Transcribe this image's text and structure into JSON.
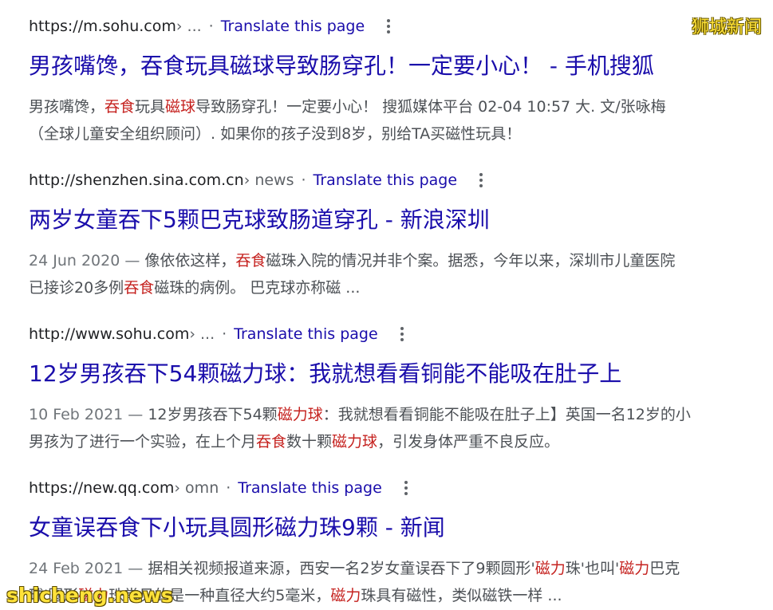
{
  "watermarks": {
    "top_right": "狮城新闻",
    "bottom_left": "shicheng.news"
  },
  "results": [
    {
      "url_domain": "https://m.sohu.com",
      "url_path": " › ...",
      "separator": "·",
      "translate": "Translate this page",
      "title": "男孩嘴馋，吞食玩具磁球导致肠穿孔！一定要小心！ - 手机搜狐",
      "snippet_line1": [
        {
          "text": "男孩嘴馋，",
          "hl": false
        },
        {
          "text": "吞食",
          "hl": true
        },
        {
          "text": "玩具",
          "hl": false
        },
        {
          "text": "磁球",
          "hl": true
        },
        {
          "text": "导致肠穿孔！一定要小心！ 搜狐媒体平台 02-04 10:57 大. 文/张咏梅",
          "hl": false
        }
      ],
      "snippet_line2": [
        {
          "text": "（全球儿童安全组织顾问）. 如果你的孩子没到8岁，别给TA买磁性玩具！",
          "hl": false
        }
      ]
    },
    {
      "url_domain": "http://shenzhen.sina.com.cn",
      "url_path": " › news",
      "separator": "·",
      "translate": "Translate this page",
      "title": "两岁女童吞下5颗巴克球致肠道穿孔 - 新浪深圳",
      "date": "24 Jun 2020 — ",
      "snippet_line1": [
        {
          "text": "像依依这样，",
          "hl": false
        },
        {
          "text": "吞食",
          "hl": true
        },
        {
          "text": "磁珠入院的情况并非个案。据悉，今年以来，深圳市儿童医院",
          "hl": false
        }
      ],
      "snippet_line2": [
        {
          "text": "已接诊20多例",
          "hl": false
        },
        {
          "text": "吞食",
          "hl": true
        },
        {
          "text": "磁珠的病例。 巴克球亦称磁 ...",
          "hl": false
        }
      ]
    },
    {
      "url_domain": "http://www.sohu.com",
      "url_path": " › ...",
      "separator": "·",
      "translate": "Translate this page",
      "title": "12岁男孩吞下54颗磁力球：我就想看看铜能不能吸在肚子上",
      "date": "10 Feb 2021 — ",
      "snippet_line1": [
        {
          "text": "12岁男孩吞下54颗",
          "hl": false
        },
        {
          "text": "磁力球",
          "hl": true
        },
        {
          "text": "：我就想看看铜能不能吸在肚子上】英国一名12岁的小",
          "hl": false
        }
      ],
      "snippet_line2": [
        {
          "text": "男孩为了进行一个实验，在上个月",
          "hl": false
        },
        {
          "text": "吞食",
          "hl": true
        },
        {
          "text": "数十颗",
          "hl": false
        },
        {
          "text": "磁力球",
          "hl": true
        },
        {
          "text": "，引发身体严重不良反应。",
          "hl": false
        }
      ]
    },
    {
      "url_domain": "https://new.qq.com",
      "url_path": " › omn",
      "separator": "·",
      "translate": "Translate this page",
      "title": "女童误吞食下小玩具圆形磁力珠9颗 - 新闻",
      "date": "24 Feb 2021 — ",
      "snippet_line1": [
        {
          "text": "据相关视频报道来源，西安一名2岁女童误吞下了9颗圆形'",
          "hl": false
        },
        {
          "text": "磁力",
          "hl": true
        },
        {
          "text": "珠'也叫'",
          "hl": false
        },
        {
          "text": "磁力",
          "hl": true
        },
        {
          "text": "巴克",
          "hl": false
        }
      ],
      "snippet_line2": [
        {
          "text": "球'圆形",
          "hl": false
        },
        {
          "text": "磁力",
          "hl": true
        },
        {
          "text": "珠常见的是一种直径大约5毫米，",
          "hl": false
        },
        {
          "text": "磁力",
          "hl": true
        },
        {
          "text": "珠具有磁性，类似磁铁一样 ...",
          "hl": false
        }
      ]
    }
  ]
}
